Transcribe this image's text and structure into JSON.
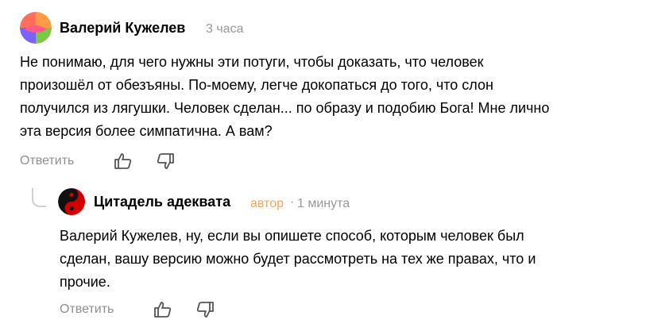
{
  "comments": [
    {
      "author": "Валерий Кужелев",
      "time": "3 часа",
      "text_lines": [
        "Не понимаю, для чего нужны эти потуги, чтобы доказать, что человек",
        "произошёл от обезъяны. По-моему, легче докопаться до того, что слон",
        "получился из лягушки. Человек сделан... по образу и подобию Бога! Мне лично",
        "эта версия более симпатична. А вам?"
      ],
      "reply_label": "Ответить",
      "avatar_icon": "tulip-avatar-icon"
    },
    {
      "author": "Цитадель адеквата",
      "badge": "автор",
      "separator": "·",
      "time": "1 минута",
      "text_lines": [
        "Валерий Кужелев, ну, если вы опишете способ, которым человек был",
        "сделан, вашу версию можно будет рассмотреть на тех же правах, что и",
        "прочие."
      ],
      "reply_label": "Ответить",
      "avatar_icon": "yin-yang-avatar-icon"
    }
  ],
  "icons": {
    "like": "thumbs-up-icon",
    "dislike": "thumbs-down-icon",
    "thread": "reply-thread-icon"
  },
  "colors": {
    "badge": "#f6a55d",
    "meta": "#999999",
    "action": "#8f8f8f",
    "avatar1_orange": "#ff8a3c",
    "avatar1_pink": "#ff5a8a",
    "avatar1_purple": "#7b61ff",
    "avatar1_green": "#7ac943",
    "avatar2_red": "#d40000"
  }
}
